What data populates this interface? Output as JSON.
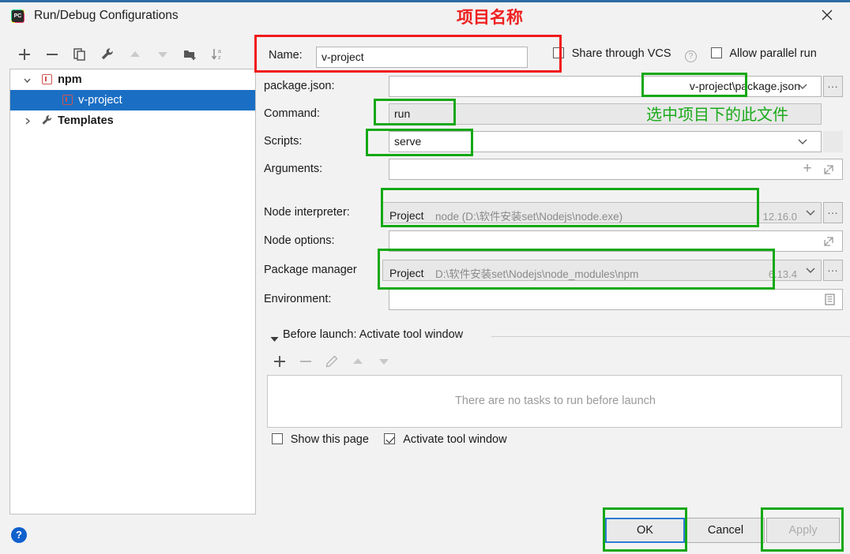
{
  "window": {
    "title": "Run/Debug Configurations",
    "icon": "pycharm-icon",
    "close_label": "✕"
  },
  "toolbar": {
    "items": [
      {
        "name": "add-configuration-button",
        "glyph": "plus",
        "enabled": true
      },
      {
        "name": "remove-configuration-button",
        "glyph": "minus",
        "enabled": true
      },
      {
        "name": "copy-configuration-button",
        "glyph": "copy",
        "enabled": true
      },
      {
        "name": "edit-templates-button",
        "glyph": "wrench",
        "enabled": true
      },
      {
        "name": "move-up-button",
        "glyph": "arrow-up",
        "enabled": false
      },
      {
        "name": "move-down-button",
        "glyph": "arrow-down",
        "enabled": false
      },
      {
        "name": "new-folder-button",
        "glyph": "folder-add",
        "enabled": true
      },
      {
        "name": "sort-button",
        "glyph": "sort-az",
        "enabled": true
      }
    ]
  },
  "tree": {
    "nodes": [
      {
        "label": "npm",
        "level": 0,
        "expanded": true,
        "selected": false,
        "icon": "npm-icon",
        "has_twisty": true
      },
      {
        "label": "v-project",
        "level": 1,
        "expanded": false,
        "selected": true,
        "icon": "npm-icon",
        "has_twisty": false
      },
      {
        "label": "Templates",
        "level": 0,
        "expanded": false,
        "selected": false,
        "icon": "wrench-icon",
        "has_twisty": true
      }
    ]
  },
  "form": {
    "name_label": "Name:",
    "name_value": "v-project",
    "share_vcs_label": "Share through VCS",
    "share_vcs_checked": false,
    "allow_parallel_label": "Allow parallel run",
    "allow_parallel_checked": false,
    "package_json_label": "package.json:",
    "package_json_value": "v-project\\package.json",
    "command_label": "Command:",
    "command_value": "run",
    "scripts_label": "Scripts:",
    "scripts_value": "serve",
    "arguments_label": "Arguments:",
    "arguments_value": "",
    "node_interpreter_label": "Node interpreter:",
    "node_interpreter_scope": "Project",
    "node_interpreter_path": "node (D:\\软件安装set\\Nodejs\\node.exe)",
    "node_interpreter_version": "12.16.0",
    "node_options_label": "Node options:",
    "node_options_value": "",
    "package_manager_label": "Package manager",
    "package_manager_scope": "Project",
    "package_manager_path": "D:\\软件安装set\\Nodejs\\node_modules\\npm",
    "package_manager_version": "6.13.4",
    "environment_label": "Environment:",
    "environment_value": "",
    "browse_label": "..."
  },
  "before_launch": {
    "title": "Before launch: Activate tool window",
    "expanded": true,
    "empty_text": "There are no tasks to run before launch",
    "toolbar": [
      {
        "name": "add-task-button",
        "glyph": "plus",
        "enabled": true
      },
      {
        "name": "remove-task-button",
        "glyph": "minus",
        "enabled": false
      },
      {
        "name": "edit-task-button",
        "glyph": "pencil",
        "enabled": false
      },
      {
        "name": "task-move-up-button",
        "glyph": "arrow-up",
        "enabled": false
      },
      {
        "name": "task-move-down-button",
        "glyph": "arrow-down",
        "enabled": false
      }
    ],
    "show_page_label": "Show this page",
    "show_page_checked": false,
    "activate_window_label": "Activate tool window",
    "activate_window_checked": true
  },
  "buttons": {
    "ok": "OK",
    "cancel": "Cancel",
    "apply": "Apply",
    "apply_enabled": false,
    "help": "?"
  },
  "annotations": {
    "project_name_note": "项目名称",
    "select_file_note": "选中项目下的此文件",
    "red_color": "#f01a1a",
    "green_color": "#14a814"
  }
}
